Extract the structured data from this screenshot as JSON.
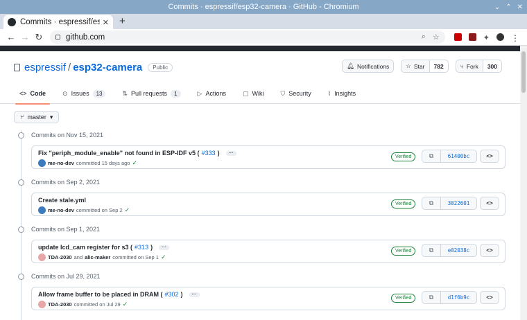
{
  "window": {
    "title": "Commits · espressif/esp32-camera · GitHub - Chromium"
  },
  "browser": {
    "tab_title": "Commits · espressif/esp32-c",
    "address": "github.com"
  },
  "repo": {
    "owner": "espressif",
    "name": "esp32-camera",
    "visibility": "Public",
    "notifications_label": "Notifications",
    "star_label": "Star",
    "star_count": "782",
    "fork_label": "Fork",
    "fork_count": "300"
  },
  "tabs": [
    {
      "label": "Code",
      "icon": "code-icon",
      "active": true
    },
    {
      "label": "Issues",
      "icon": "issue-icon",
      "count": "13"
    },
    {
      "label": "Pull requests",
      "icon": "pull-request-icon",
      "count": "1"
    },
    {
      "label": "Actions",
      "icon": "play-icon"
    },
    {
      "label": "Wiki",
      "icon": "book-icon"
    },
    {
      "label": "Security",
      "icon": "shield-icon"
    },
    {
      "label": "Insights",
      "icon": "graph-icon"
    }
  ],
  "branch": "master",
  "verified_label": "Verified",
  "groups": [
    {
      "date": "Commits on Nov 15, 2021",
      "commit": {
        "message": "Fix \"periph_module_enable\" not found in ESP-IDF v5 (",
        "pr": "#333",
        "message_end": ")",
        "author": "me-no-dev",
        "coauthor_text": "",
        "coauthor": "",
        "when": "committed 15 days ago",
        "sha": "61400bc",
        "has_more": true
      }
    },
    {
      "date": "Commits on Sep 2, 2021",
      "commit": {
        "message": "Create stale.yml",
        "pr": "",
        "message_end": "",
        "author": "me-no-dev",
        "coauthor_text": "",
        "coauthor": "",
        "when": "committed on Sep 2",
        "sha": "3022601",
        "has_more": false
      }
    },
    {
      "date": "Commits on Sep 1, 2021",
      "commit": {
        "message": "update lcd_cam register for s3 (",
        "pr": "#313",
        "message_end": ")",
        "author": "TDA-2030",
        "coauthor_text": "and",
        "coauthor": "alic-maker",
        "when": "committed on Sep 1",
        "sha": "e02038c",
        "has_more": true
      }
    },
    {
      "date": "Commits on Jul 29, 2021",
      "commit": {
        "message": "Allow frame buffer to be placed in DRAM (",
        "pr": "#302",
        "message_end": ")",
        "author": "TDA-2030",
        "coauthor_text": "",
        "coauthor": "",
        "when": "committed on Jul 29",
        "sha": "d1f6b9c",
        "has_more": true
      }
    }
  ]
}
